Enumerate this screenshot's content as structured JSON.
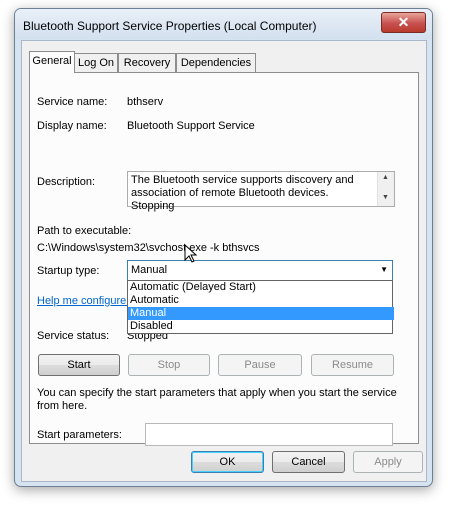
{
  "window": {
    "title": "Bluetooth Support Service Properties (Local Computer)"
  },
  "tabs": [
    "General",
    "Log On",
    "Recovery",
    "Dependencies"
  ],
  "general": {
    "service_name_label": "Service name:",
    "service_name_value": "bthserv",
    "display_name_label": "Display name:",
    "display_name_value": "Bluetooth Support Service",
    "description_label": "Description:",
    "description_value": "The Bluetooth service supports discovery and association of remote Bluetooth devices.  Stopping",
    "path_label": "Path to executable:",
    "path_value": "C:\\Windows\\system32\\svchost.exe -k bthsvcs",
    "startup_type_label": "Startup type:",
    "startup_type_value": "Manual",
    "startup_options": [
      "Automatic (Delayed Start)",
      "Automatic",
      "Manual",
      "Disabled"
    ],
    "help_link": "Help me configure s",
    "service_status_label": "Service status:",
    "service_status_value": "Stopped",
    "buttons": {
      "start": "Start",
      "stop": "Stop",
      "pause": "Pause",
      "resume": "Resume"
    },
    "start_params_info": "You can specify the start parameters that apply when you start the service from here.",
    "start_params_label": "Start parameters:",
    "start_params_value": ""
  },
  "footer": {
    "ok": "OK",
    "cancel": "Cancel",
    "apply": "Apply"
  },
  "icons": {
    "close": "close-icon",
    "dropdown": "chevron-down-icon",
    "pointer": "mouse-pointer-icon"
  }
}
